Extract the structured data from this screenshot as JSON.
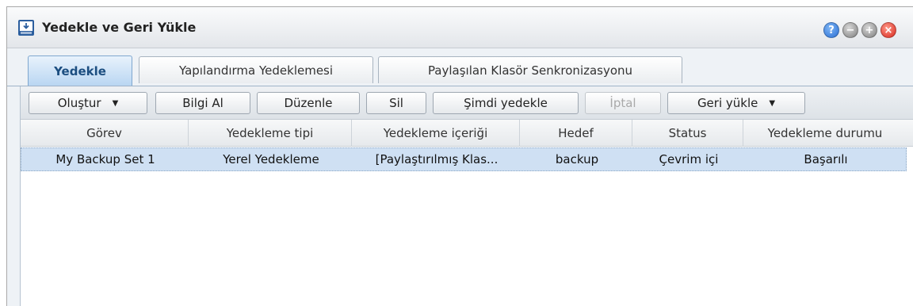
{
  "window": {
    "title": "Yedekle ve Geri Yükle",
    "icon": "backup-disk-icon",
    "controls": {
      "help": "?",
      "minimize": "−",
      "maximize": "+",
      "close": "×"
    }
  },
  "tabs": [
    {
      "label": "Yedekle",
      "active": true
    },
    {
      "label": "Yapılandırma Yedeklemesi",
      "active": false
    },
    {
      "label": "Paylaşılan Klasör Senkronizasyonu",
      "active": false
    }
  ],
  "toolbar": {
    "create": "Oluştur",
    "info": "Bilgi Al",
    "edit": "Düzenle",
    "delete": "Sil",
    "backup_now": "Şimdi yedekle",
    "cancel": "İptal",
    "restore": "Geri yükle"
  },
  "table": {
    "columns": [
      "Görev",
      "Yedekleme tipi",
      "Yedekleme içeriği",
      "Hedef",
      "Status",
      "Yedekleme durumu"
    ],
    "rows": [
      [
        "My Backup Set 1",
        "Yerel Yedekleme",
        "[Paylaştırılmış Klas...",
        "backup",
        "Çevrim içi",
        "Başarılı"
      ]
    ],
    "selected_row": 0
  },
  "colors": {
    "accent_tab": "#b9d6f2",
    "selected_row": "#cfe0f3",
    "close_button": "#d7261c",
    "help_button": "#2a6fd4"
  }
}
